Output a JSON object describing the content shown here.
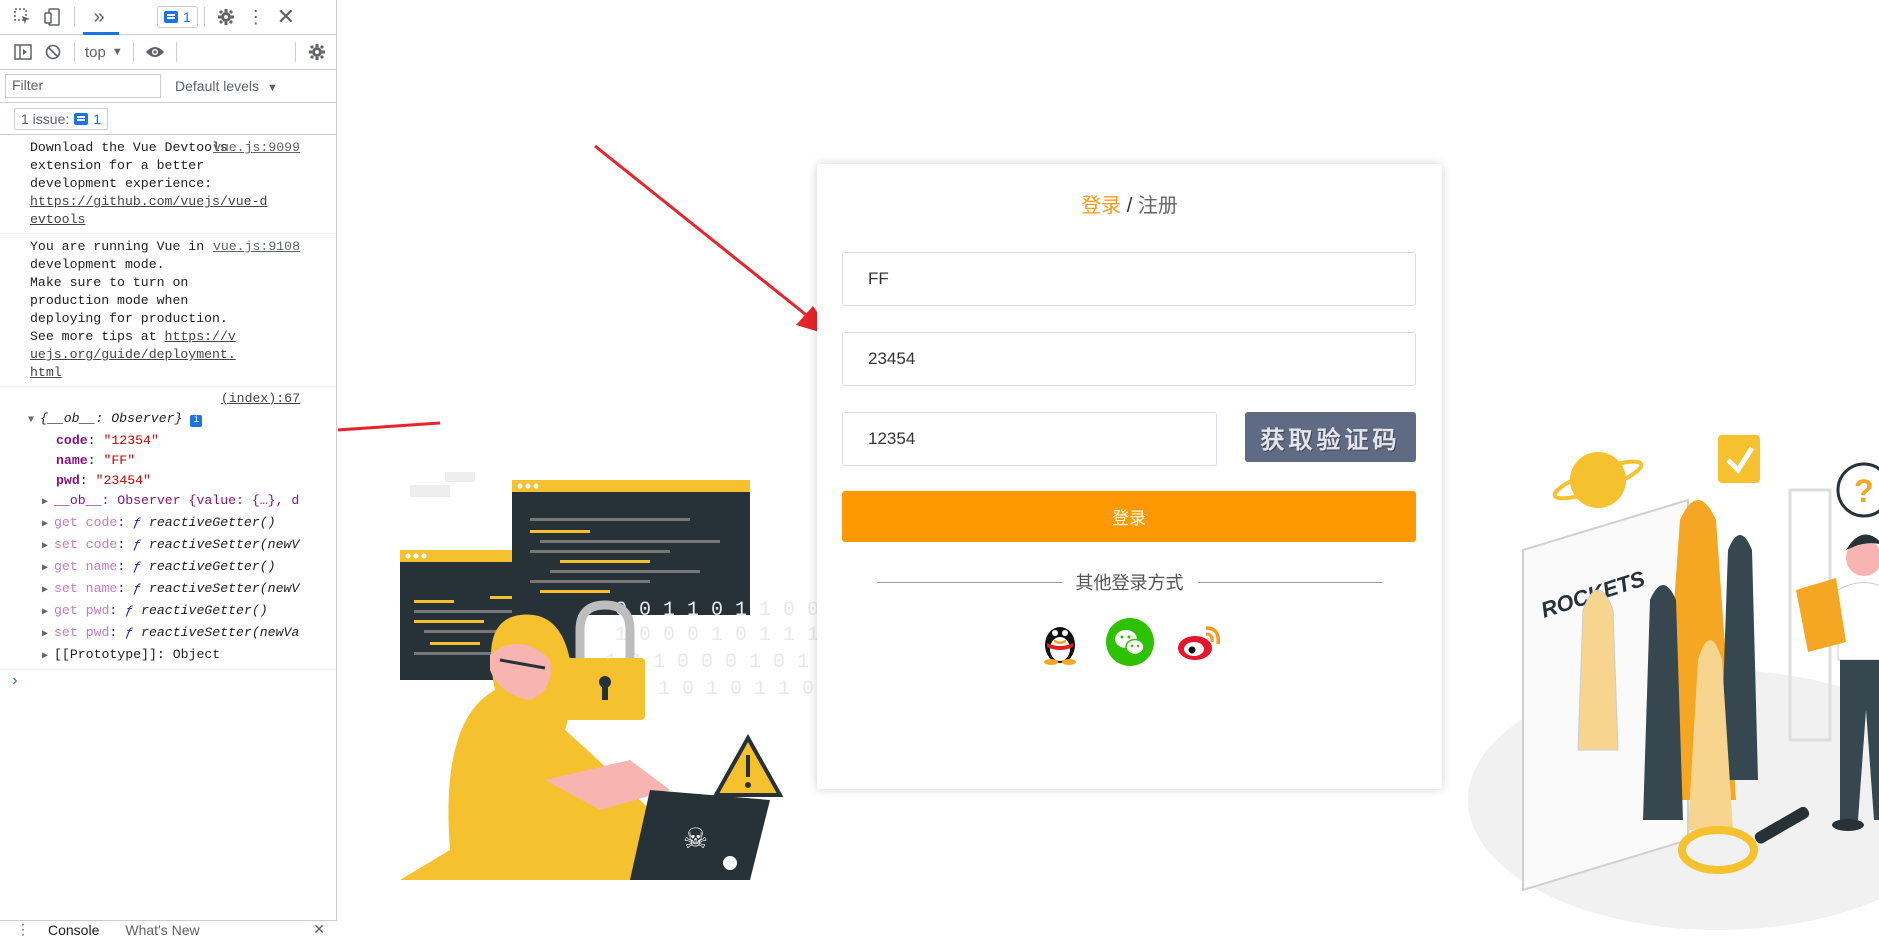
{
  "devtools": {
    "toolbar": {
      "issue_count": "1"
    },
    "console_toolbar": {
      "context": "top",
      "levels": "Default levels"
    },
    "filter": {
      "placeholder": "Filter"
    },
    "issues": {
      "label": "1 issue:",
      "count": "1"
    },
    "messages": [
      {
        "source": "vue.js:9099",
        "text": "Download the Vue Devtools extension for a better development experience:",
        "link": "https://github.com/vuejs/vue-devtools"
      },
      {
        "source": "vue.js:9108",
        "text": "You are running Vue in development mode.\nMake sure to turn on production mode when deploying for production.\nSee more tips at",
        "link": "https://vuejs.org/guide/deployment.html"
      }
    ],
    "log": {
      "source": "(index):67",
      "summary": "{__ob__: Observer}",
      "props": [
        {
          "key": "code",
          "value": "\"12354\""
        },
        {
          "key": "name",
          "value": "\"FF\""
        },
        {
          "key": "pwd",
          "value": "\"23454\""
        }
      ],
      "ob_line": "__ob__: Observer {value: {…}, d",
      "accessors": [
        {
          "prefix": "get code",
          "fn": "reactiveGetter()"
        },
        {
          "prefix": "set code",
          "fn": "reactiveSetter(newV"
        },
        {
          "prefix": "get name",
          "fn": "reactiveGetter()"
        },
        {
          "prefix": "set name",
          "fn": "reactiveSetter(newV"
        },
        {
          "prefix": "get pwd",
          "fn": "reactiveGetter()"
        },
        {
          "prefix": "set pwd",
          "fn": "reactiveSetter(newVa"
        }
      ],
      "prototype": "[[Prototype]]: Object"
    },
    "drawer": {
      "tab1": "Console",
      "tab2": "What's New"
    }
  },
  "login": {
    "title_active": "登录",
    "title_sep": " / ",
    "title_other": "注册",
    "username": "FF",
    "password": "23454",
    "code": "12354",
    "captcha_text": "获取验证码",
    "login_button": "登录",
    "other_methods": "其他登录方式",
    "socials": [
      "qq-icon",
      "wechat-icon",
      "weibo-icon"
    ]
  },
  "illustration": {
    "rockets_sign": "ROCKETS",
    "binary": [
      "0 0 1 1 0 1 1 0 0 1 1 1",
      "1 0 0 0 1 0 1 1 1 0 0 0",
      "1 0 1 0 0 0 1 0 1 1 0 0 0",
      "0 0 1 0 1 0 1 1 0"
    ]
  },
  "colors": {
    "accent": "#fe9903",
    "title_active": "#f79a1b",
    "captcha_bg": "#5f6b85",
    "devtools_blue": "#1a73e8",
    "arrow_red": "#e8232a"
  }
}
